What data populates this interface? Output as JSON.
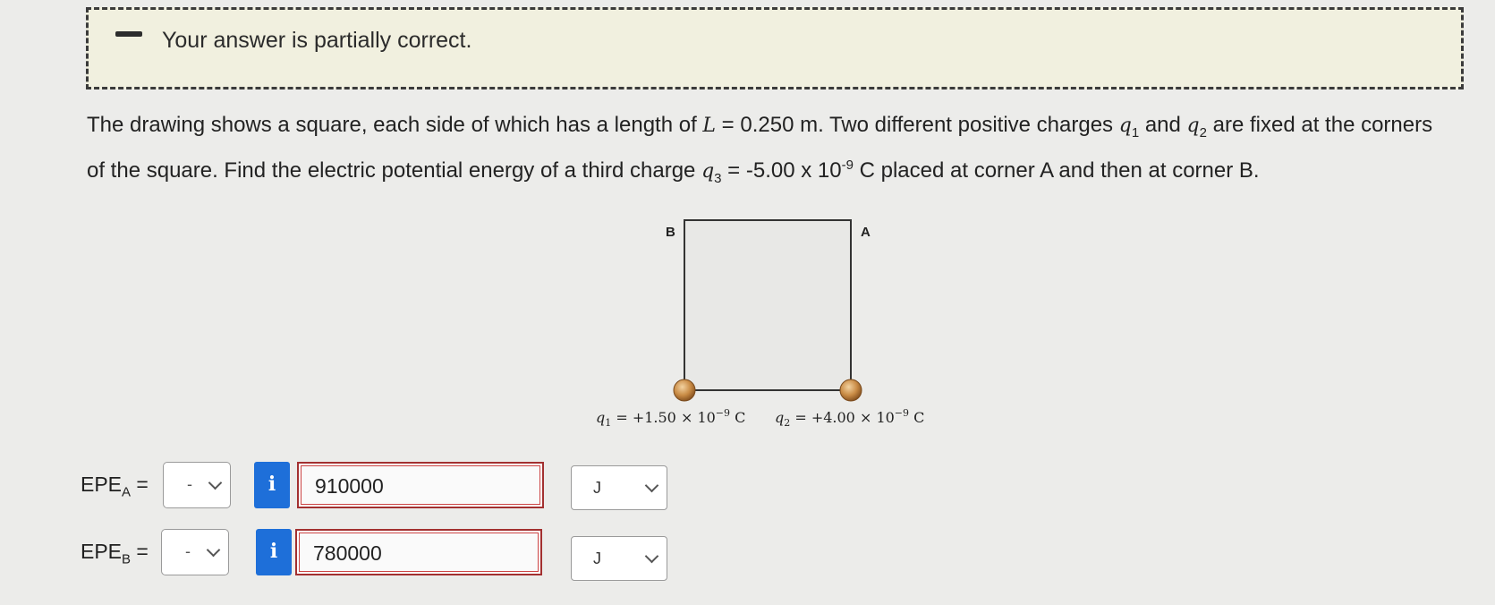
{
  "feedback": {
    "message": "Your answer is partially correct."
  },
  "problem": {
    "text_1": "The drawing shows a square, each side of which has a length of ",
    "L_sym": "L",
    "L_val": " = 0.250 m. Two different positive charges ",
    "q": "q",
    "sub1": "1",
    "and": " and ",
    "sub2": "2",
    "text_2": " are fixed at the corners of the square. Find the electric potential energy of a third charge ",
    "sub3": "3",
    "q3_val": " = -5.00 x 10",
    "exp": "-9",
    "text_3": " C placed at corner A and then at corner B."
  },
  "figure": {
    "corner_a": "A",
    "corner_b": "B",
    "q1_label": "q",
    "q1_sub": "1",
    "q1_value": " = +1.50 × 10",
    "q1_exp": "−9",
    "q1_unit": " C",
    "q2_label": "q",
    "q2_sub": "2",
    "q2_value": " = +4.00 × 10",
    "q2_exp": "−9",
    "q2_unit": " C"
  },
  "answers": [
    {
      "label": "EPE",
      "sub": "A",
      "eq": " =",
      "sign": "-",
      "info": "i",
      "value": "910000",
      "unit": "J"
    },
    {
      "label": "EPE",
      "sub": "B",
      "eq": " =",
      "sign": "-",
      "info": "i",
      "value": "780000",
      "unit": "J"
    }
  ]
}
